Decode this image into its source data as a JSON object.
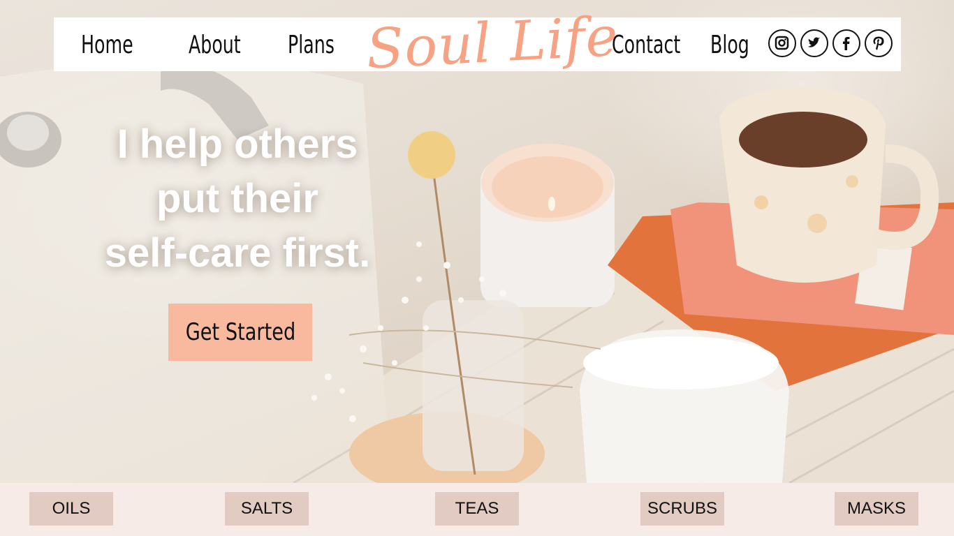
{
  "nav": {
    "links": [
      {
        "label": "Home"
      },
      {
        "label": "About"
      },
      {
        "label": "Plans"
      },
      {
        "label": "Contact"
      },
      {
        "label": "Blog"
      }
    ],
    "brand": "Soul Life",
    "social": [
      "instagram-icon",
      "twitter-icon",
      "facebook-icon",
      "pinterest-icon"
    ]
  },
  "hero": {
    "headline": [
      "I help others",
      "put their",
      "self-care first."
    ],
    "cta_label": "Get Started"
  },
  "categories": [
    {
      "label": "OILS"
    },
    {
      "label": "SALTS"
    },
    {
      "label": "TEAS"
    },
    {
      "label": "SCRUBS"
    },
    {
      "label": "MASKS"
    }
  ],
  "colors": {
    "brand": "#f7a283",
    "cta_bg": "#f8b99e",
    "category_bg": "#e2cbc3",
    "category_bar_bg": "#f6ebe7",
    "nav_bg": "#ffffff"
  }
}
